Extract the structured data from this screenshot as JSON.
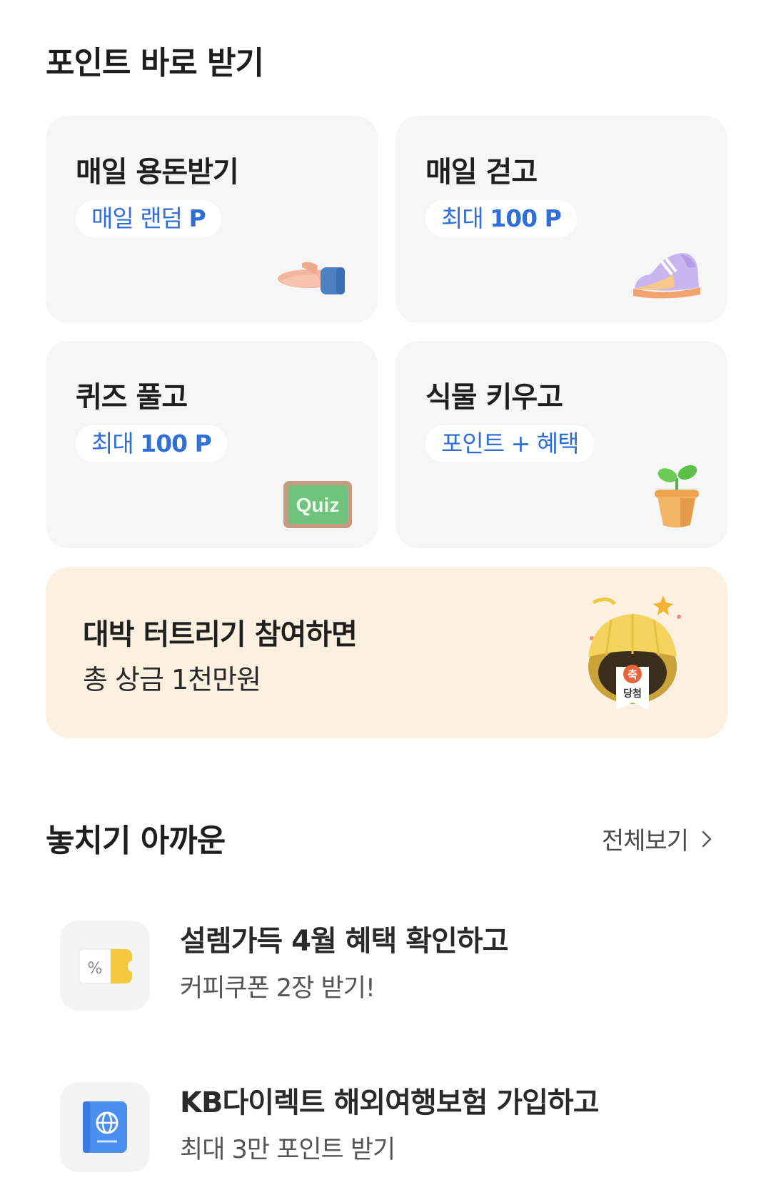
{
  "points_section": {
    "title": "포인트 바로 받기",
    "cards": [
      {
        "title": "매일 용돈받기",
        "pill_text": "매일 랜덤",
        "pill_bold": "P",
        "icon": "hand-icon"
      },
      {
        "title": "매일 걷고",
        "pill_text": "최대",
        "pill_bold": "100 P",
        "icon": "sneaker-icon"
      },
      {
        "title": "퀴즈 풀고",
        "pill_text": "최대",
        "pill_bold": "100 P",
        "icon": "quiz-board-icon",
        "icon_label": "Quiz"
      },
      {
        "title": "식물 키우고",
        "pill_text": "포인트 + 혜택",
        "pill_bold": "",
        "icon": "plant-pot-icon"
      }
    ]
  },
  "banner": {
    "title": "대박 터트리기 참여하면",
    "subtitle": "총 상금 1천만원",
    "icon": "lucky-ball-icon",
    "badge_top": "축",
    "badge_bottom": "당첨"
  },
  "missed_section": {
    "title": "놓치기 아까운",
    "see_all": "전체보기",
    "items": [
      {
        "title": "설렘가득 4월 혜택 확인하고",
        "subtitle": "커피쿠폰 2장 받기!",
        "icon": "coupon-icon",
        "icon_label": "%"
      },
      {
        "title": "KB다이렉트 해외여행보험 가입하고",
        "subtitle": "최대 3만 포인트 받기",
        "icon": "passport-icon"
      }
    ]
  },
  "colors": {
    "accent_blue": "#2f6fd6",
    "card_bg": "#f6f6f7",
    "banner_bg": "#fcf1e0"
  }
}
